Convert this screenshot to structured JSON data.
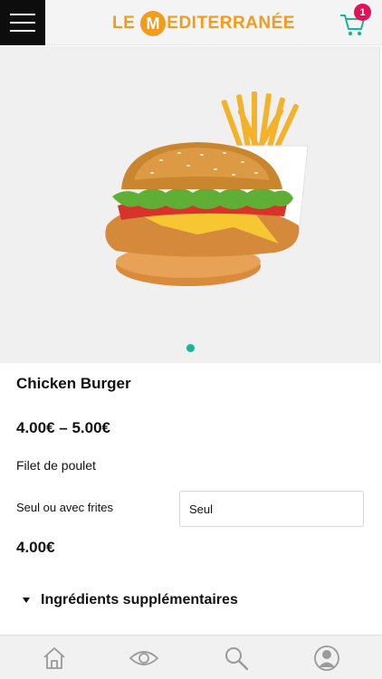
{
  "header": {
    "logo": {
      "prefix": "LE",
      "initial": "M",
      "suffix": "EDITERRANÉE"
    },
    "cart_count": "1"
  },
  "product": {
    "title": "Chicken Burger",
    "price_range": "4.00€ – 5.00€",
    "description": "Filet de poulet",
    "option_label": "Seul ou avec frites",
    "option_selected": "Seul",
    "selected_price": "4.00€",
    "extras_label": "Ingrédients supplémentaires"
  },
  "colors": {
    "brand_orange": "#f29b1d",
    "accent_teal": "#1bb39a",
    "badge_pink": "#e4105a"
  },
  "bottom_nav": [
    "home-icon",
    "eye-icon",
    "search-icon",
    "user-icon"
  ]
}
